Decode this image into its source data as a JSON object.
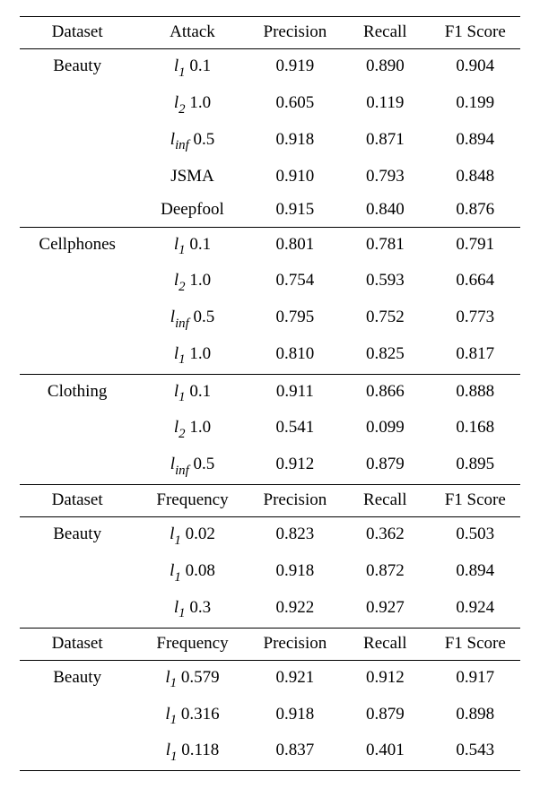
{
  "headers": {
    "dataset": "Dataset",
    "attack": "Attack",
    "frequency": "Frequency",
    "precision": "Precision",
    "recall": "Recall",
    "f1": "F1 Score"
  },
  "sec1": {
    "groups": [
      {
        "dataset": "Beauty",
        "rows": [
          {
            "atk": {
              "lnorm": "1",
              "val": "0.1"
            },
            "p": "0.919",
            "r": "0.890",
            "f": "0.904"
          },
          {
            "atk": {
              "lnorm": "2",
              "val": "1.0"
            },
            "p": "0.605",
            "r": "0.119",
            "f": "0.199"
          },
          {
            "atk": {
              "lnorm": "inf",
              "val": "0.5"
            },
            "p": "0.918",
            "r": "0.871",
            "f": "0.894"
          },
          {
            "atk": {
              "plain": "JSMA"
            },
            "p": "0.910",
            "r": "0.793",
            "f": "0.848"
          },
          {
            "atk": {
              "plain": "Deepfool"
            },
            "p": "0.915",
            "r": "0.840",
            "f": "0.876"
          }
        ]
      },
      {
        "dataset": "Cellphones",
        "rows": [
          {
            "atk": {
              "lnorm": "1",
              "val": "0.1"
            },
            "p": "0.801",
            "r": "0.781",
            "f": "0.791"
          },
          {
            "atk": {
              "lnorm": "2",
              "val": "1.0"
            },
            "p": "0.754",
            "r": "0.593",
            "f": "0.664"
          },
          {
            "atk": {
              "lnorm": "inf",
              "val": "0.5"
            },
            "p": "0.795",
            "r": "0.752",
            "f": "0.773"
          },
          {
            "atk": {
              "lnorm": "1",
              "val": "1.0"
            },
            "p": "0.810",
            "r": "0.825",
            "f": "0.817"
          }
        ]
      },
      {
        "dataset": "Clothing",
        "rows": [
          {
            "atk": {
              "lnorm": "1",
              "val": "0.1"
            },
            "p": "0.911",
            "r": "0.866",
            "f": "0.888"
          },
          {
            "atk": {
              "lnorm": "2",
              "val": "1.0"
            },
            "p": "0.541",
            "r": "0.099",
            "f": "0.168"
          },
          {
            "atk": {
              "lnorm": "inf",
              "val": "0.5"
            },
            "p": "0.912",
            "r": "0.879",
            "f": "0.895"
          }
        ]
      }
    ]
  },
  "sec2": {
    "dataset": "Beauty",
    "rows": [
      {
        "atk": {
          "lnorm": "1",
          "val": "0.02"
        },
        "p": "0.823",
        "r": "0.362",
        "f": "0.503"
      },
      {
        "atk": {
          "lnorm": "1",
          "val": "0.08"
        },
        "p": "0.918",
        "r": "0.872",
        "f": "0.894"
      },
      {
        "atk": {
          "lnorm": "1",
          "val": "0.3"
        },
        "p": "0.922",
        "r": "0.927",
        "f": "0.924"
      }
    ]
  },
  "sec3": {
    "dataset": "Beauty",
    "rows": [
      {
        "atk": {
          "lnorm": "1",
          "val": "0.579"
        },
        "p": "0.921",
        "r": "0.912",
        "f": "0.917"
      },
      {
        "atk": {
          "lnorm": "1",
          "val": "0.316"
        },
        "p": "0.918",
        "r": "0.879",
        "f": "0.898"
      },
      {
        "atk": {
          "lnorm": "1",
          "val": "0.118"
        },
        "p": "0.837",
        "r": "0.401",
        "f": "0.543"
      }
    ]
  },
  "norm_labels": {
    "1": "1",
    "2": "2",
    "inf": "inf"
  },
  "l_symbol": "l"
}
